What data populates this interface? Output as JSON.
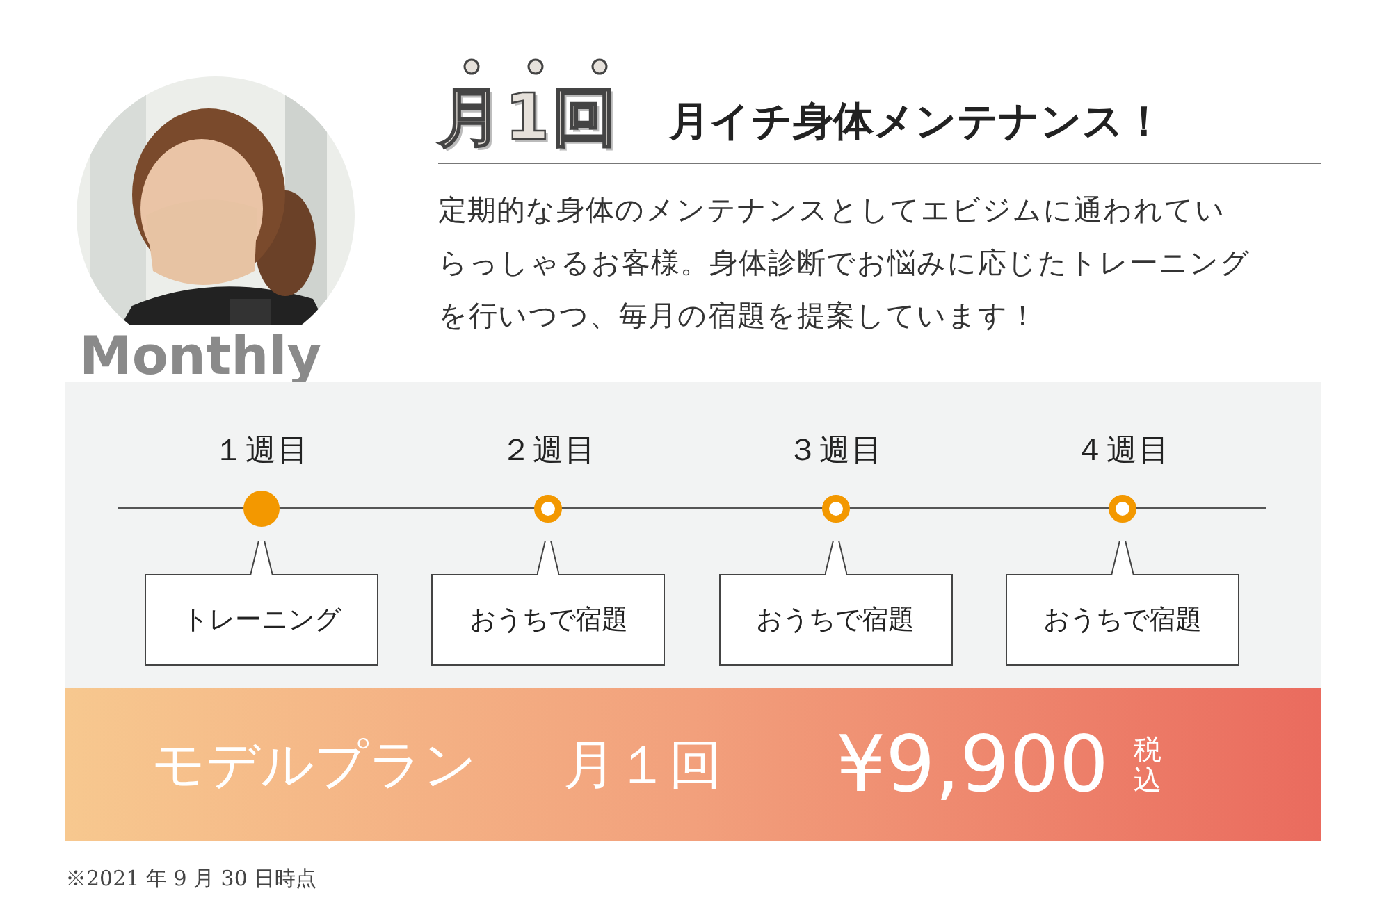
{
  "badge": "Monthly",
  "heading": {
    "emphasis": "月1回",
    "title": "月イチ身体メンテナンス！"
  },
  "description": "定期的な身体のメンテナンスとしてエビジムに通われていらっしゃるお客様。身体診断でお悩みに応じたトレーニングを行いつつ、毎月の宿題を提案しています！",
  "timeline": [
    {
      "week": "１週目",
      "task": "トレーニング",
      "active": true
    },
    {
      "week": "２週目",
      "task": "おうちで宿題",
      "active": false
    },
    {
      "week": "３週目",
      "task": "おうちで宿題",
      "active": false
    },
    {
      "week": "４週目",
      "task": "おうちで宿題",
      "active": false
    }
  ],
  "plan": {
    "label": "モデルプラン",
    "frequency": "月１回",
    "price": "¥9,900",
    "tax": "税込"
  },
  "footnote": "※2021 年 9 月 30 日時点"
}
